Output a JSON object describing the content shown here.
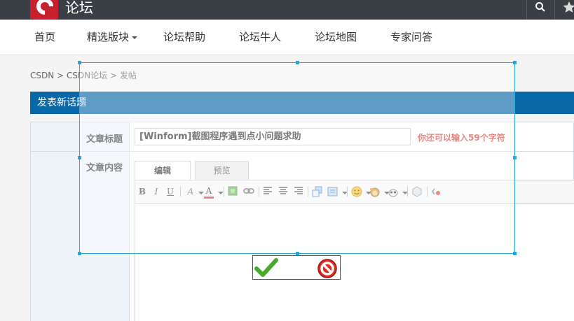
{
  "header": {
    "site_name": "论坛",
    "search_icon": "search-icon",
    "star_icon": "star-icon",
    "logo_icon": "csdn-logo-icon"
  },
  "nav": {
    "items": [
      {
        "label": "首页"
      },
      {
        "label": "精选版块"
      },
      {
        "label": "论坛帮助"
      },
      {
        "label": "论坛牛人"
      },
      {
        "label": "论坛地图"
      },
      {
        "label": "专家问答"
      }
    ]
  },
  "breadcrumb": {
    "items": [
      "CSDN",
      "CSDN论坛",
      "发帖"
    ],
    "separator": ">"
  },
  "section": {
    "title": "发表新话题"
  },
  "form": {
    "title_label": "文章标题",
    "title_value": "[Winform]截图程序遇到点小问题求助",
    "char_hint": "你还可以输入59个字符",
    "content_label": "文章内容",
    "tabs": [
      {
        "label": "编辑",
        "active": true
      },
      {
        "label": "预览",
        "active": false
      }
    ],
    "toolbar": {
      "bold": "B",
      "italic": "I",
      "underline": "U",
      "font_style": "A",
      "font_color": "A",
      "icons": [
        "image-icon",
        "link-icon",
        "align-left-icon",
        "align-center-icon",
        "align-right-icon",
        "code-icon",
        "insert-icon",
        "emoji-icon",
        "monkey-emoji-icon",
        "onion-emoji-icon",
        "flash-icon",
        "source-icon"
      ]
    },
    "editor_value": ""
  },
  "colors": {
    "accent": "#0868a8",
    "hint_red": "#d9483b",
    "selection_border": "#2aa7d8",
    "brand_red": "#c9202f"
  }
}
